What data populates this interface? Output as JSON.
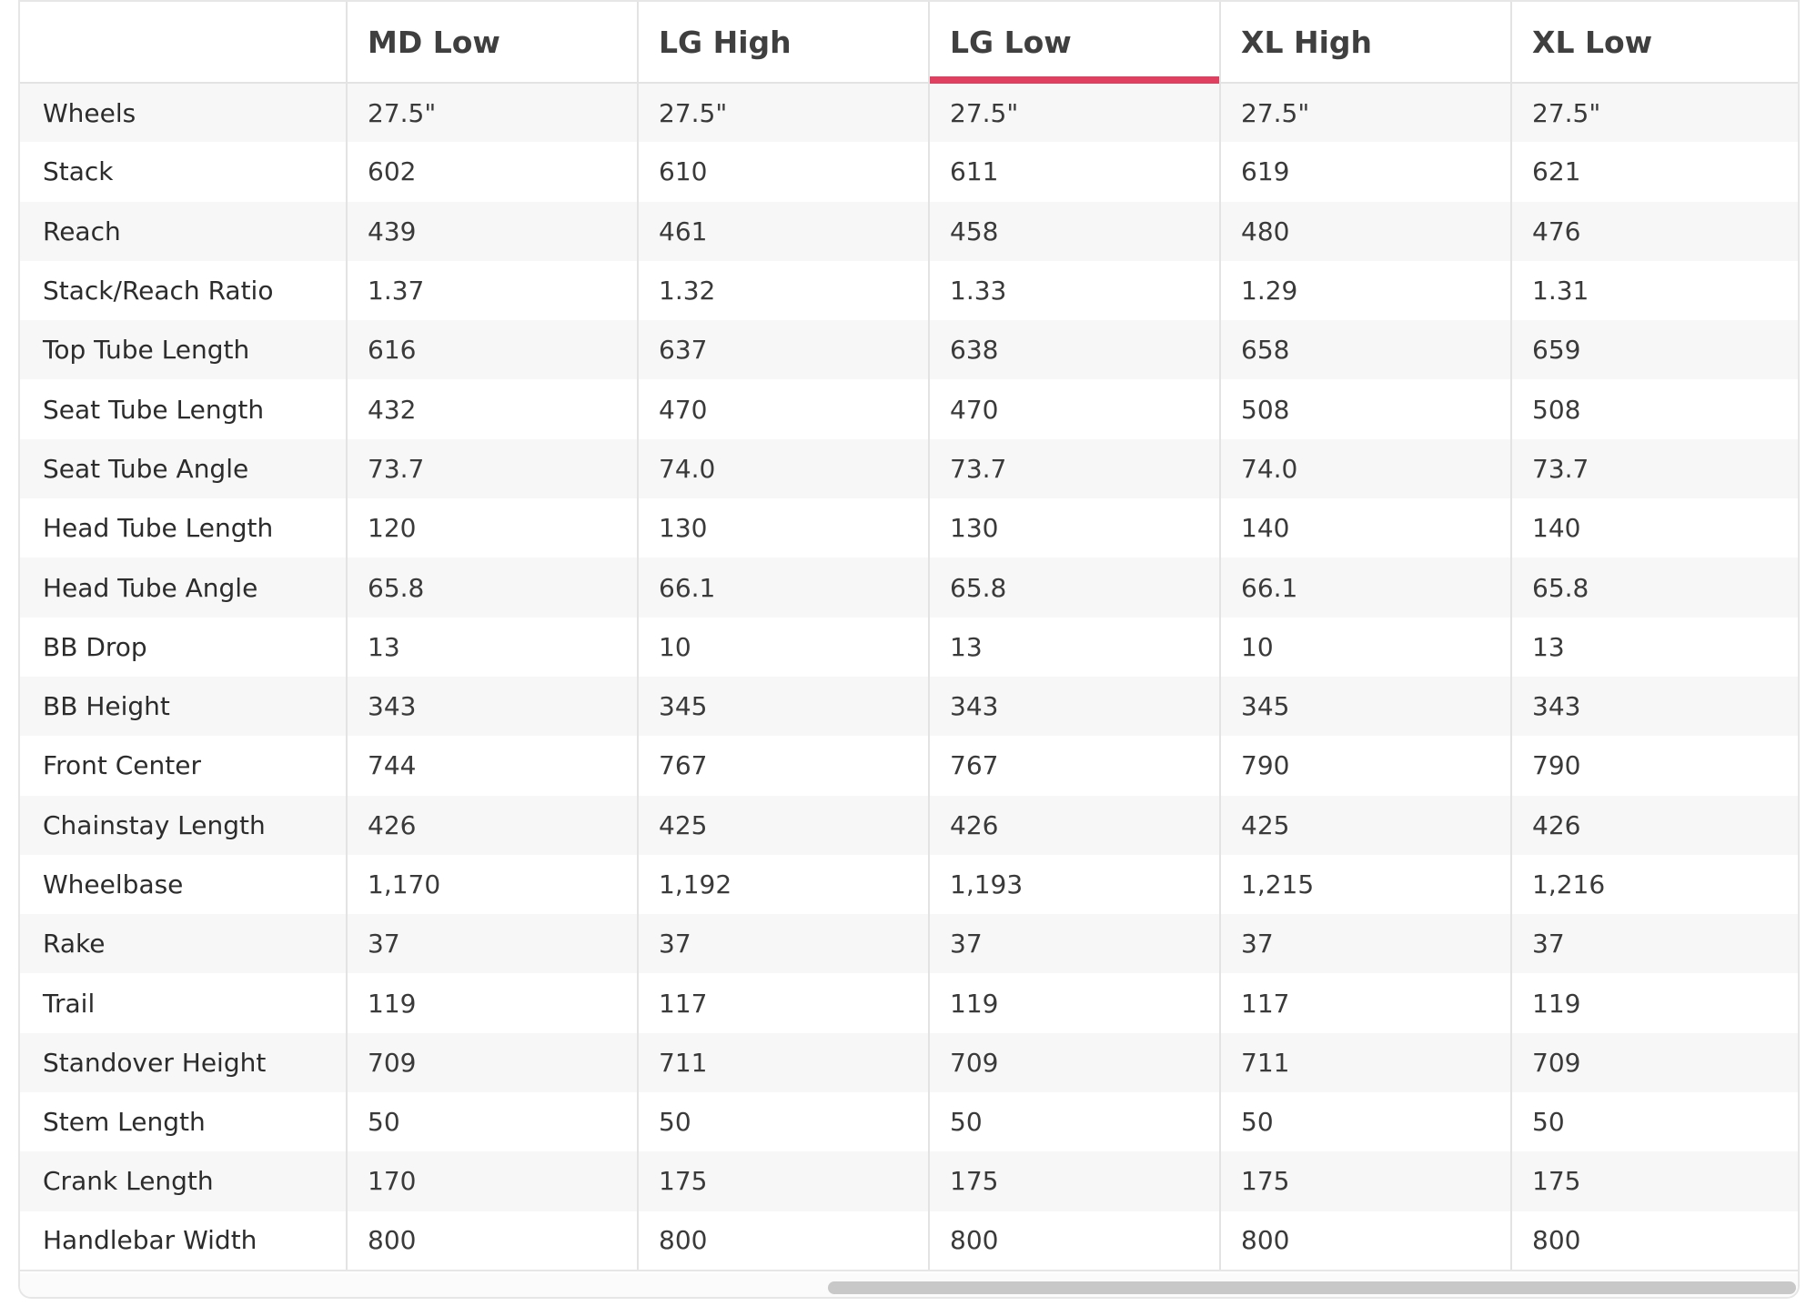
{
  "table": {
    "columns": [
      "",
      "MD Low",
      "LG High",
      "LG Low",
      "XL High",
      "XL Low"
    ],
    "active_column": "LG Low",
    "accent_color": "#e0405f",
    "rows": [
      {
        "label": "Wheels",
        "values": [
          "27.5\"",
          "27.5\"",
          "27.5\"",
          "27.5\"",
          "27.5\""
        ]
      },
      {
        "label": "Stack",
        "values": [
          "602",
          "610",
          "611",
          "619",
          "621"
        ]
      },
      {
        "label": "Reach",
        "values": [
          "439",
          "461",
          "458",
          "480",
          "476"
        ]
      },
      {
        "label": "Stack/Reach Ratio",
        "values": [
          "1.37",
          "1.32",
          "1.33",
          "1.29",
          "1.31"
        ]
      },
      {
        "label": "Top Tube Length",
        "values": [
          "616",
          "637",
          "638",
          "658",
          "659"
        ]
      },
      {
        "label": "Seat Tube Length",
        "values": [
          "432",
          "470",
          "470",
          "508",
          "508"
        ]
      },
      {
        "label": "Seat Tube Angle",
        "values": [
          "73.7",
          "74.0",
          "73.7",
          "74.0",
          "73.7"
        ]
      },
      {
        "label": "Head Tube Length",
        "values": [
          "120",
          "130",
          "130",
          "140",
          "140"
        ]
      },
      {
        "label": "Head Tube Angle",
        "values": [
          "65.8",
          "66.1",
          "65.8",
          "66.1",
          "65.8"
        ]
      },
      {
        "label": "BB Drop",
        "values": [
          "13",
          "10",
          "13",
          "10",
          "13"
        ]
      },
      {
        "label": "BB Height",
        "values": [
          "343",
          "345",
          "343",
          "345",
          "343"
        ]
      },
      {
        "label": "Front Center",
        "values": [
          "744",
          "767",
          "767",
          "790",
          "790"
        ]
      },
      {
        "label": "Chainstay Length",
        "values": [
          "426",
          "425",
          "426",
          "425",
          "426"
        ]
      },
      {
        "label": "Wheelbase",
        "values": [
          "1,170",
          "1,192",
          "1,193",
          "1,215",
          "1,216"
        ]
      },
      {
        "label": "Rake",
        "values": [
          "37",
          "37",
          "37",
          "37",
          "37"
        ]
      },
      {
        "label": "Trail",
        "values": [
          "119",
          "117",
          "119",
          "117",
          "119"
        ]
      },
      {
        "label": "Standover Height",
        "values": [
          "709",
          "711",
          "709",
          "711",
          "709"
        ]
      },
      {
        "label": "Stem Length",
        "values": [
          "50",
          "50",
          "50",
          "50",
          "50"
        ]
      },
      {
        "label": "Crank Length",
        "values": [
          "170",
          "175",
          "175",
          "175",
          "175"
        ]
      },
      {
        "label": "Handlebar Width",
        "values": [
          "800",
          "800",
          "800",
          "800",
          "800"
        ]
      }
    ]
  }
}
